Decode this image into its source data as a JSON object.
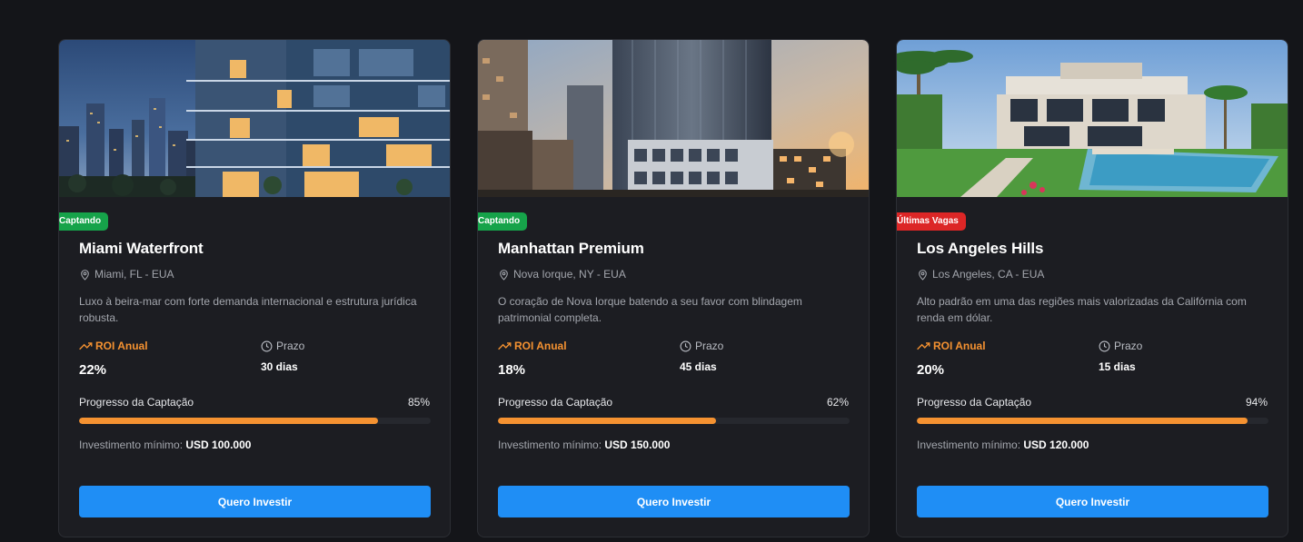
{
  "cards": [
    {
      "badge": "Captando",
      "badge_color": "#16a34a",
      "title": "Miami Waterfront",
      "location": "Miami, FL - EUA",
      "description": "Luxo à beira-mar com forte demanda internacional e estrutura jurídica robusta.",
      "roi_label": "ROI Anual",
      "roi_value": "22%",
      "term_label": "Prazo",
      "term_value": "30 dias",
      "progress_label": "Progresso da Captação",
      "progress_pct": "85%",
      "progress": 0.85,
      "min_label": "Investimento mínimo:",
      "min_value": "USD 100.000",
      "button": "Quero Investir"
    },
    {
      "badge": "Captando",
      "badge_color": "#16a34a",
      "title": "Manhattan Premium",
      "location": "Nova Iorque, NY - EUA",
      "description": "O coração de Nova Iorque batendo a seu favor com blindagem patrimonial completa.",
      "roi_label": "ROI Anual",
      "roi_value": "18%",
      "term_label": "Prazo",
      "term_value": "45 dias",
      "progress_label": "Progresso da Captação",
      "progress_pct": "62%",
      "progress": 0.62,
      "min_label": "Investimento mínimo:",
      "min_value": "USD 150.000",
      "button": "Quero Investir"
    },
    {
      "badge": "Últimas Vagas",
      "badge_color": "#dc2626",
      "title": "Los Angeles Hills",
      "location": "Los Angeles, CA - EUA",
      "description": "Alto padrão em uma das regiões mais valorizadas da Califórnia com renda em dólar.",
      "roi_label": "ROI Anual",
      "roi_value": "20%",
      "term_label": "Prazo",
      "term_value": "15 dias",
      "progress_label": "Progresso da Captação",
      "progress_pct": "94%",
      "progress": 0.94,
      "min_label": "Investimento mínimo:",
      "min_value": "USD 120.000",
      "button": "Quero Investir"
    }
  ],
  "colors": {
    "background": "#141519",
    "card": "#1c1d22",
    "accent_orange": "#f59231",
    "button_blue": "#1f8ef5",
    "badge_green": "#16a34a",
    "badge_red": "#dc2626"
  }
}
